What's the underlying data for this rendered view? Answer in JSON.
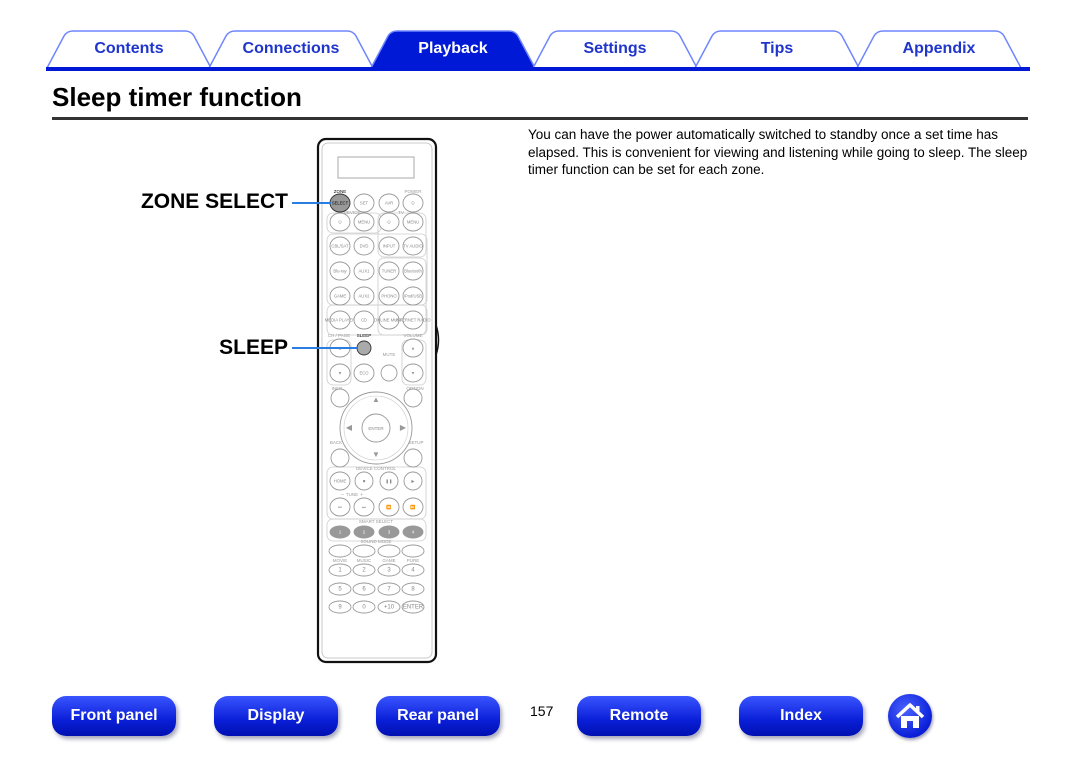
{
  "tabs": [
    {
      "label": "Contents"
    },
    {
      "label": "Connections"
    },
    {
      "label": "Playback",
      "active": true
    },
    {
      "label": "Settings"
    },
    {
      "label": "Tips"
    },
    {
      "label": "Appendix"
    }
  ],
  "page": {
    "title": "Sleep timer function",
    "description": "You can have the power automatically switched to standby once a set time has elapsed. This is convenient for viewing and listening while going to sleep. The sleep timer function can be set for each zone.",
    "page_number": "157"
  },
  "callouts": {
    "zone_select": "ZONE SELECT",
    "sleep": "SLEEP"
  },
  "remote": {
    "labels": {
      "zone": "ZONE",
      "power": "POWER",
      "device": "DEVICE",
      "tv": "TV",
      "ch_page": "CH / PAGE",
      "sleep": "SLEEP",
      "volume": "VOLUME",
      "mute": "MUTE",
      "info": "INFO",
      "option": "OPTION",
      "back": "BACK",
      "setup": "SETUP",
      "device_control": "DEVICE CONTROL",
      "tune": "－ TUNE ＋",
      "smart_select": "SMART SELECT",
      "sound_mode": "SOUND MODE"
    },
    "rows": [
      [
        "SELECT",
        "SET",
        "AVR",
        "⏻"
      ],
      [
        "⏻",
        "MENU",
        "⏻",
        "MENU"
      ],
      [
        "CBL/SAT",
        "DVD",
        "INPUT",
        "TV AUDIO"
      ],
      [
        "Blu-ray",
        "AUX1",
        "TUNER",
        "Bluetooth"
      ],
      [
        "GAME",
        "AUX2",
        "PHONO",
        "iPod/USB"
      ],
      [
        "MEDIA PLAYER",
        "CD",
        "ONLINE MUSIC",
        "INTERNET RADIO"
      ],
      [
        "▲",
        "",
        "",
        "▲"
      ],
      [
        "▼",
        "ECO",
        "",
        "▼"
      ],
      [
        "HOME",
        "■",
        "❚❚",
        "▶"
      ],
      [
        "⏮",
        "⏭",
        "⏪",
        "⏩"
      ],
      [
        "1",
        "2",
        "3",
        "4"
      ],
      [
        "",
        "",
        "",
        ""
      ],
      [
        "1",
        "2",
        "3",
        "4"
      ],
      [
        "5",
        "6",
        "7",
        "8"
      ],
      [
        "9",
        "0",
        "+10",
        "ENTER"
      ]
    ],
    "sound_modes": [
      "MOVIE",
      "MUSIC",
      "GAME",
      "PURE"
    ],
    "enter": "ENTER"
  },
  "footer": [
    {
      "label": "Front panel"
    },
    {
      "label": "Display"
    },
    {
      "label": "Rear panel"
    },
    {
      "label": "Remote"
    },
    {
      "label": "Index"
    }
  ],
  "home_icon": "home-icon",
  "colors": {
    "accent": "#0019d6",
    "tab_text": "#1f35cc",
    "callout_line": "#2a7de1"
  }
}
